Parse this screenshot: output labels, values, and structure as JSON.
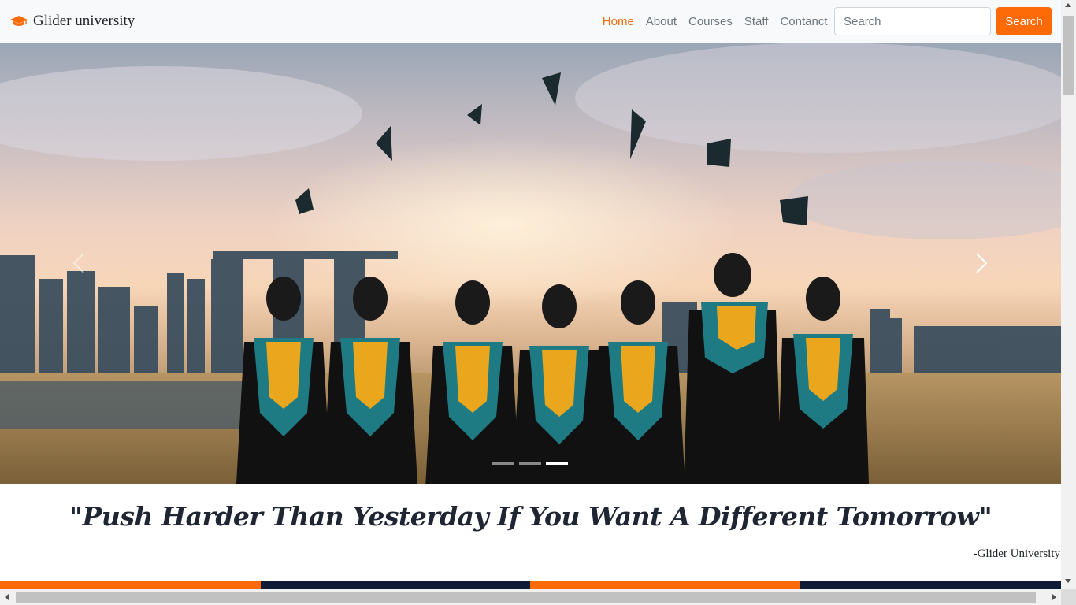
{
  "navbar": {
    "brand_icon": "graduation-cap-icon",
    "brand_name": "Glider university",
    "links": [
      {
        "label": "Home",
        "active": true
      },
      {
        "label": "About",
        "active": false
      },
      {
        "label": "Courses",
        "active": false
      },
      {
        "label": "Staff",
        "active": false
      },
      {
        "label": "Contanct",
        "active": false
      }
    ],
    "search_placeholder": "Search",
    "search_button_label": "Search"
  },
  "carousel": {
    "image_description_icon": "graduation-photo",
    "prev_icon": "chevron-left-icon",
    "next_icon": "chevron-right-icon",
    "slide_count": 3,
    "active_slide": 3
  },
  "quote": {
    "text": "\"Push Harder Than Yesterday If You Want A Different Tomorrow\"",
    "author": "-Glider University"
  },
  "colors": {
    "accent": "#fd6b08",
    "active_link": "#f26a0f",
    "navy": "#0e1b36",
    "strip": [
      "#fd6b08",
      "#0e1b36",
      "#fd6b08",
      "#0e1b36"
    ]
  }
}
